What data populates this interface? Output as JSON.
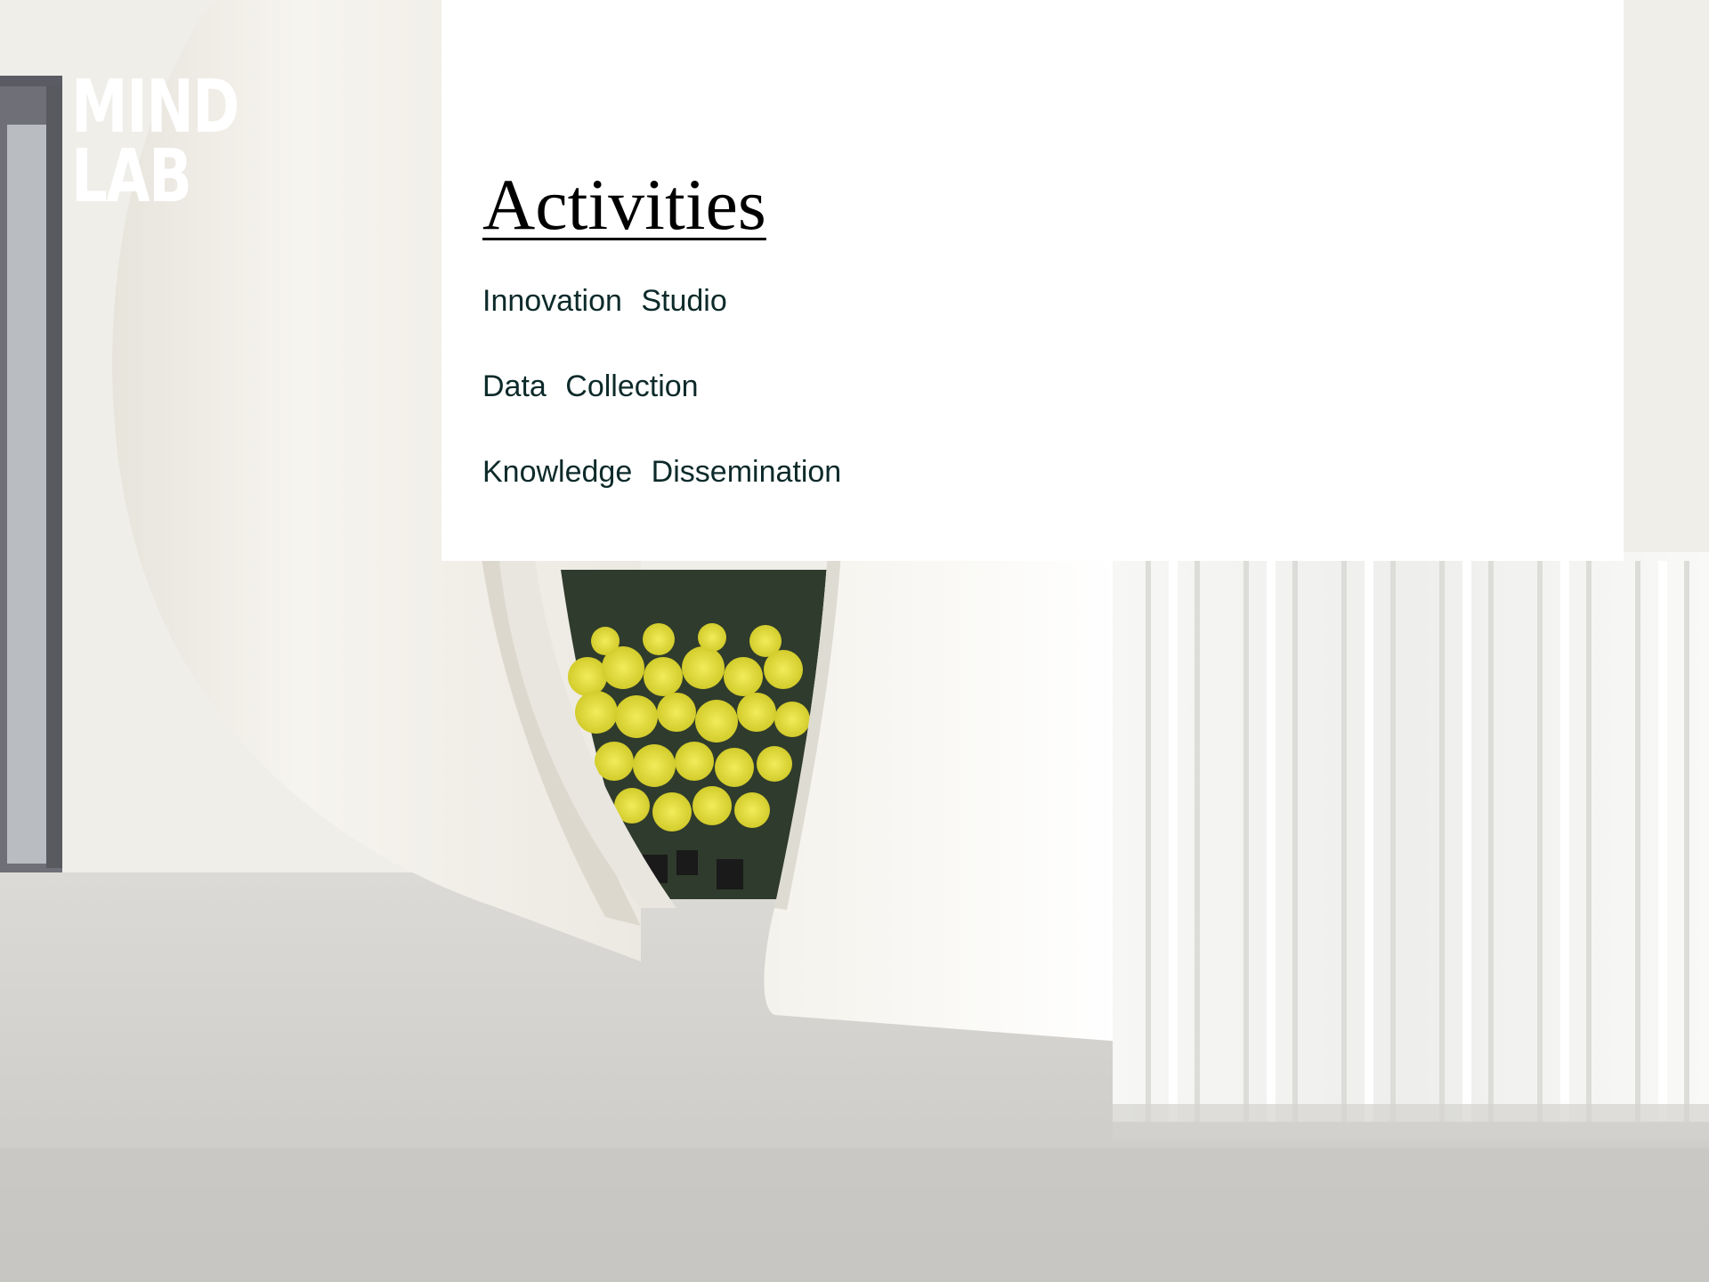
{
  "logo": {
    "line1": "MIND",
    "line2": "LAB"
  },
  "panel": {
    "title": "Activities",
    "items": [
      {
        "label": "Innovation Studio"
      },
      {
        "label": "Data Collection"
      },
      {
        "label": "Knowledge Dissemination"
      }
    ]
  },
  "colors": {
    "panel_background": "#ffffff",
    "title_text": "#000000",
    "item_text": "#0d2a2a",
    "logo_text": "#ffffff",
    "flowers": "#e8e23a"
  },
  "icons": {
    "background": "pod-with-flowers-photo"
  }
}
